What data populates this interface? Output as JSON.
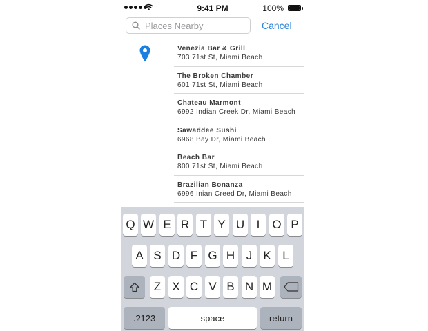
{
  "status_bar": {
    "time": "9:41 PM",
    "battery": "100%",
    "signal_icon": "signal-dots-icon",
    "wifi_icon": "wifi-icon",
    "battery_icon": "battery-icon"
  },
  "search": {
    "placeholder": "Places Nearby",
    "value": "",
    "cancel_label": "Cancel",
    "icon": "search-icon"
  },
  "accent_color": "#2a84d6",
  "pin_icon": "location-pin-icon",
  "places": [
    {
      "name": "Venezia Bar & Grill",
      "address": "703 71st St, Miami Beach"
    },
    {
      "name": "The Broken Chamber",
      "address": "601 71st St, Miami Beach"
    },
    {
      "name": "Chateau Marmont",
      "address": "6992 Indian Creek Dr, Miami Beach"
    },
    {
      "name": "Sawaddee Sushi",
      "address": "6968 Bay Dr, Miami Beach"
    },
    {
      "name": "Beach Bar",
      "address": "800 71st St, Miami Beach"
    },
    {
      "name": "Brazilian Bonanza",
      "address": "6996 Inian Creed Dr, Miami Beach"
    }
  ],
  "keyboard": {
    "row1": [
      "Q",
      "W",
      "E",
      "R",
      "T",
      "Y",
      "U",
      "I",
      "O",
      "P"
    ],
    "row2": [
      "A",
      "S",
      "D",
      "F",
      "G",
      "H",
      "J",
      "K",
      "L"
    ],
    "row3": [
      "Z",
      "X",
      "C",
      "V",
      "B",
      "N",
      "M"
    ],
    "shift_icon": "shift-icon",
    "delete_icon": "delete-icon",
    "numbers_label": ".?123",
    "space_label": "space",
    "return_label": "return"
  }
}
